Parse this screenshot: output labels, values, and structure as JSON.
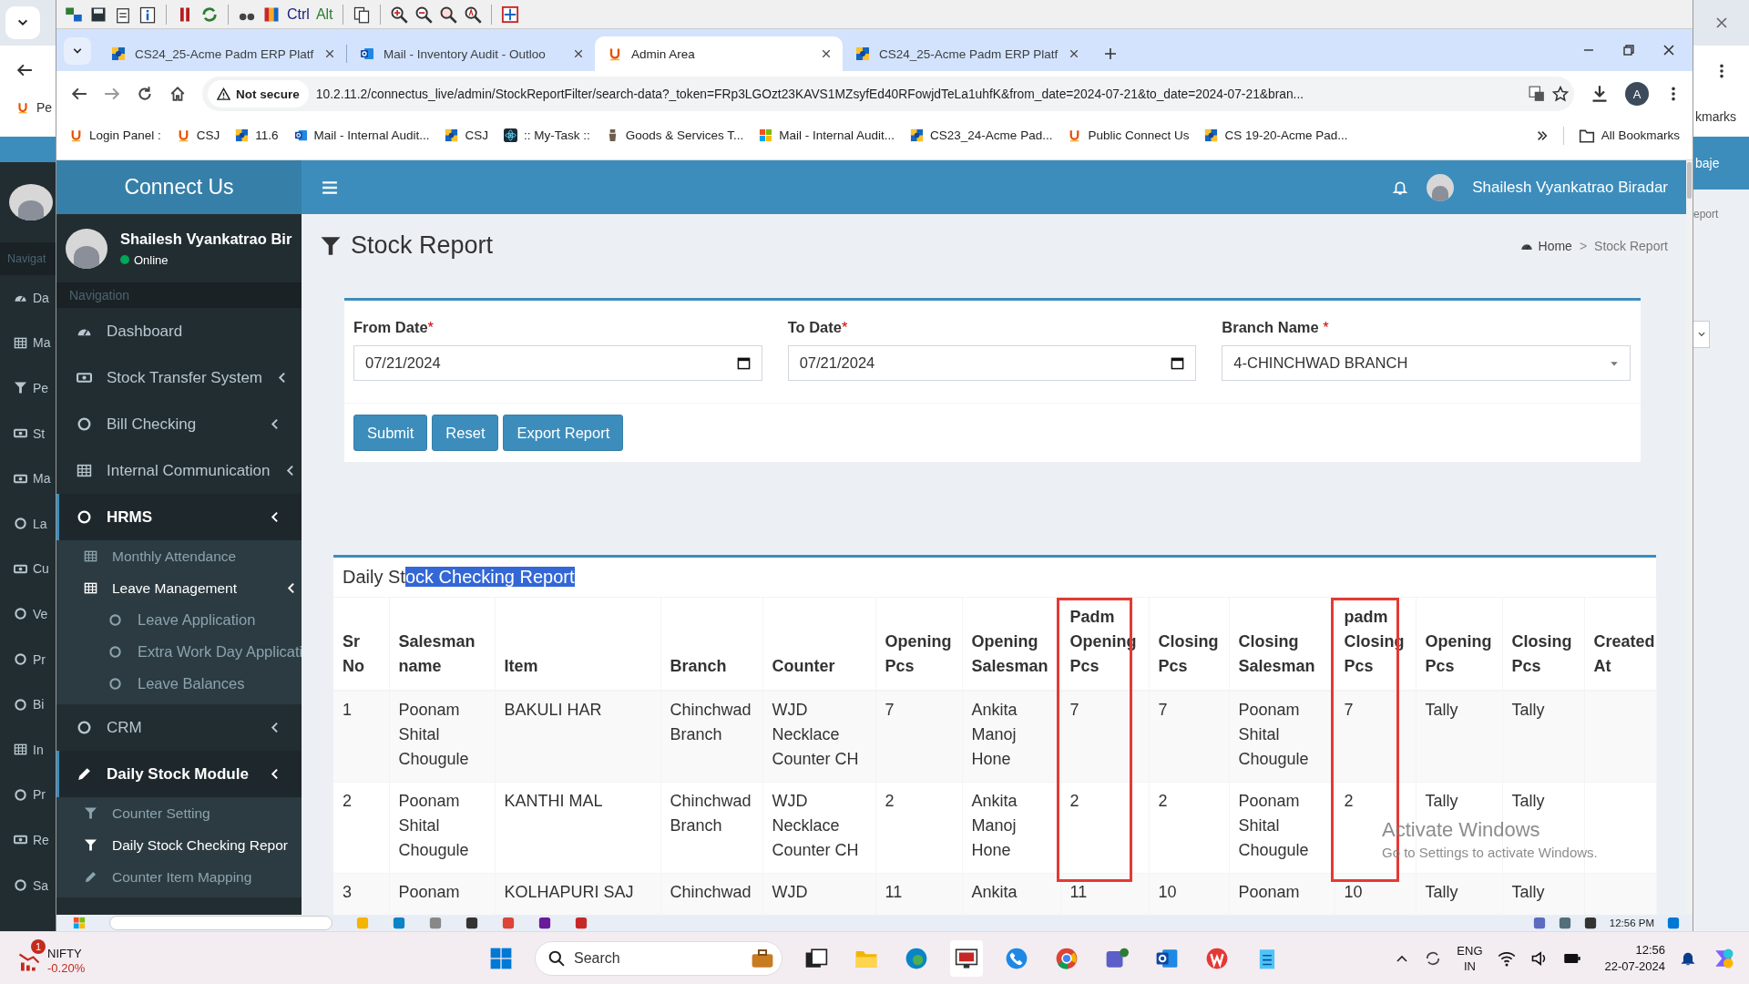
{
  "outer_window": {
    "left_bookmark": "Pe",
    "nav_header": "Navigat",
    "menu": [
      {
        "label": "Da"
      },
      {
        "label": "Ma"
      },
      {
        "label": "Pe"
      },
      {
        "label": "St"
      },
      {
        "label": "Ma"
      },
      {
        "label": "La"
      },
      {
        "label": "Cu"
      },
      {
        "label": "Ve"
      },
      {
        "label": "Pr"
      },
      {
        "label": "Bi"
      },
      {
        "label": "In"
      },
      {
        "label": "Pr"
      },
      {
        "label": "Re"
      },
      {
        "label": "Sa"
      }
    ],
    "right_bookmarks": "kmarks",
    "right_header": "baje",
    "right_breadcrumb": "eport"
  },
  "vnc_toolbar": {
    "keys": [
      "Ctrl",
      "Alt"
    ]
  },
  "browser": {
    "tabs": [
      {
        "title": "CS24_25-Acme Padm ERP Platf",
        "selected": false
      },
      {
        "title": "Mail - Inventory Audit - Outloo",
        "selected": false
      },
      {
        "title": "Admin Area",
        "selected": true
      },
      {
        "title": "CS24_25-Acme Padm ERP Platf",
        "selected": false
      }
    ],
    "security": "Not secure",
    "url": "10.2.11.2/connectus_live/admin/StockReportFilter/search-data?_token=FRp3LGOzt23KAVS1MZsyfEd40RFowjdTeLa1uhfK&from_date=2024-07-21&to_date=2024-07-21&bran...",
    "profile_initial": "A",
    "bookmarks": [
      "Login Panel :",
      "CSJ",
      "11.6",
      "Mail - Internal Audit...",
      "CSJ",
      ":: My-Task ::",
      "Goods & Services T...",
      "Mail - Internal Audit...",
      "CS23_24-Acme Pad...",
      "Public Connect Us",
      "CS 19-20-Acme Pad..."
    ],
    "all_bookmarks": "All Bookmarks"
  },
  "app": {
    "brand": "Connect Us",
    "user": {
      "name": "Shailesh Vyankatrao Bir",
      "status": "Online"
    },
    "nav_header": "Navigation",
    "menu": [
      {
        "label": "Dashboard",
        "submenu": false,
        "selected": false
      },
      {
        "label": "Stock Transfer System",
        "submenu": true,
        "selected": false
      },
      {
        "label": "Bill Checking",
        "submenu": true,
        "selected": false
      },
      {
        "label": "Internal Communication",
        "submenu": true,
        "selected": false
      },
      {
        "label": "HRMS",
        "submenu": true,
        "selected": true,
        "children": [
          {
            "label": "Monthly Attendance",
            "submenu": false,
            "selected": false
          },
          {
            "label": "Leave Management",
            "submenu": true,
            "selected": true,
            "children": [
              {
                "label": "Leave Application",
                "submenu": false,
                "selected": false
              },
              {
                "label": "Extra Work Day Applicati",
                "submenu": false,
                "selected": false
              },
              {
                "label": "Leave Balances",
                "submenu": false,
                "selected": false
              }
            ]
          }
        ]
      },
      {
        "label": "CRM",
        "submenu": true,
        "selected": false
      },
      {
        "label": "Daily Stock Module",
        "submenu": true,
        "selected": true,
        "children": [
          {
            "label": "Counter Setting",
            "submenu": false,
            "selected": false
          },
          {
            "label": "Daily Stock Checking Repor",
            "submenu": false,
            "selected": true
          },
          {
            "label": "Counter Item Mapping",
            "submenu": false,
            "selected": false
          }
        ]
      }
    ],
    "header_user": "Shailesh Vyankatrao Biradar",
    "page_title": "Stock Report",
    "breadcrumb": [
      "Home",
      "Stock Report"
    ],
    "breadcrumb_separator": ">",
    "filters": [
      {
        "label": "From Date",
        "mark": "*",
        "value": "07/21/2024",
        "kind": "date"
      },
      {
        "label": "To Date",
        "mark": "*",
        "value": "07/21/2024",
        "kind": "date"
      },
      {
        "label": "Branch Name",
        "mark": " *",
        "value": "4-CHINCHWAD BRANCH",
        "kind": "select"
      }
    ],
    "buttons": [
      "Submit",
      "Reset",
      "Export Report"
    ],
    "report": {
      "title_before": "Daily St",
      "title_highlighted": "ock Checking Report",
      "columns": [
        {
          "label": "Sr No",
          "annotated": false
        },
        {
          "label": "Salesman name",
          "annotated": false
        },
        {
          "label": "Item",
          "annotated": false
        },
        {
          "label": "Branch",
          "annotated": false
        },
        {
          "label": "Counter",
          "annotated": false
        },
        {
          "label": "Opening Pcs",
          "annotated": false
        },
        {
          "label": "Opening Salesman",
          "annotated": false
        },
        {
          "label": "Padm Opening Pcs",
          "annotated": true
        },
        {
          "label": "Closing Pcs",
          "annotated": false
        },
        {
          "label": "Closing Salesman",
          "annotated": false
        },
        {
          "label": "padm Closing Pcs",
          "annotated": true
        },
        {
          "label": "Opening Pcs",
          "annotated": false
        },
        {
          "label": "Closing Pcs",
          "annotated": false
        },
        {
          "label": "Created At",
          "annotated": false
        }
      ],
      "rows": [
        [
          "1",
          "Poonam Shital Chougule",
          "BAKULI HAR",
          "Chinchwad Branch",
          "WJD Necklace Counter CH",
          "7",
          "Ankita Manoj Hone",
          "7",
          "7",
          "Poonam Shital Chougule",
          "7",
          "Tally",
          "Tally"
        ],
        [
          "2",
          "Poonam Shital Chougule",
          "KANTHI MAL",
          "Chinchwad Branch",
          "WJD Necklace Counter CH",
          "2",
          "Ankita Manoj Hone",
          "2",
          "2",
          "Poonam Shital Chougule",
          "2",
          "Tally",
          "Tally"
        ],
        [
          "3",
          "Poonam",
          "KOLHAPURI SAJ",
          "Chinchwad",
          "WJD",
          "11",
          "Ankita",
          "11",
          "10",
          "Poonam",
          "10",
          "Tally",
          "Tally"
        ]
      ]
    }
  },
  "watermark": {
    "title": "Activate Windows",
    "hint": "Go to Settings to activate Windows."
  },
  "remote_taskbar": {
    "time": "12:56 PM"
  },
  "taskbar": {
    "ticker": {
      "name": "NIFTY",
      "change": "-0.20%",
      "badge": "1"
    },
    "search_label": "Search",
    "language": [
      "ENG",
      "IN"
    ],
    "time": "12:56",
    "date": "22-07-2024"
  }
}
